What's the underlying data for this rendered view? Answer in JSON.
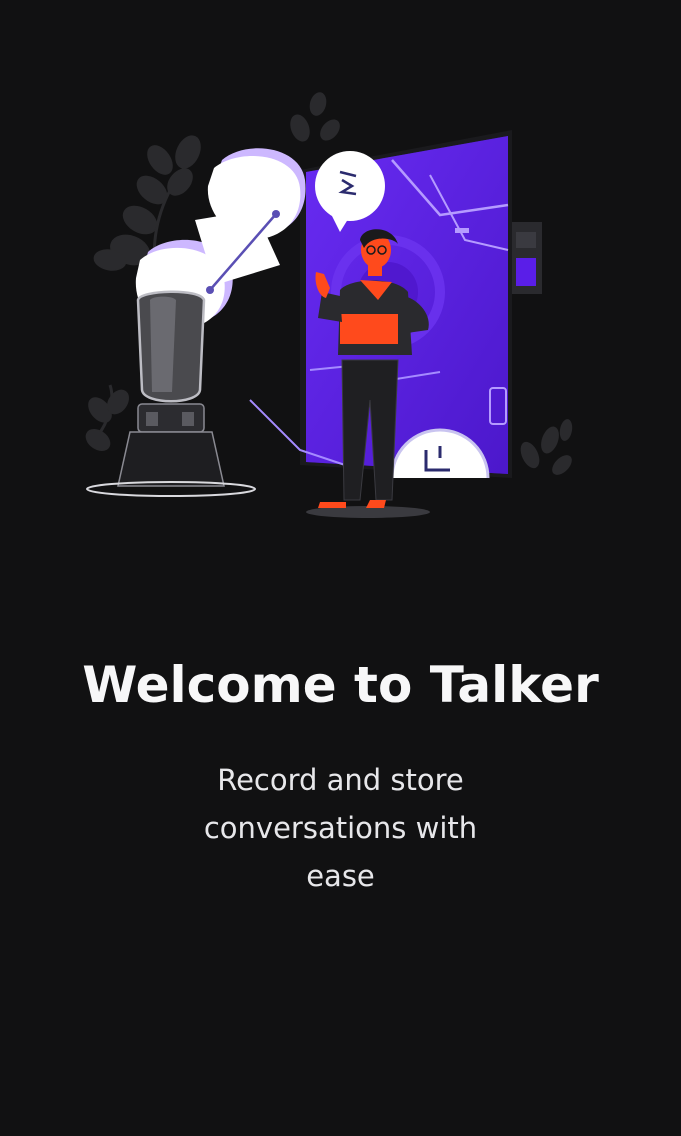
{
  "onboarding": {
    "title": "Welcome to Talker",
    "subtitle": "Record and store conversations with ease"
  },
  "illustration": {
    "description_icon": "person-presenting-robot-microphone-illustration",
    "colors": {
      "background": "#111112",
      "screen_purple": "#5a1ee8",
      "accent_orange": "#ff4a1c",
      "text_primary": "#f7f7f8"
    }
  }
}
